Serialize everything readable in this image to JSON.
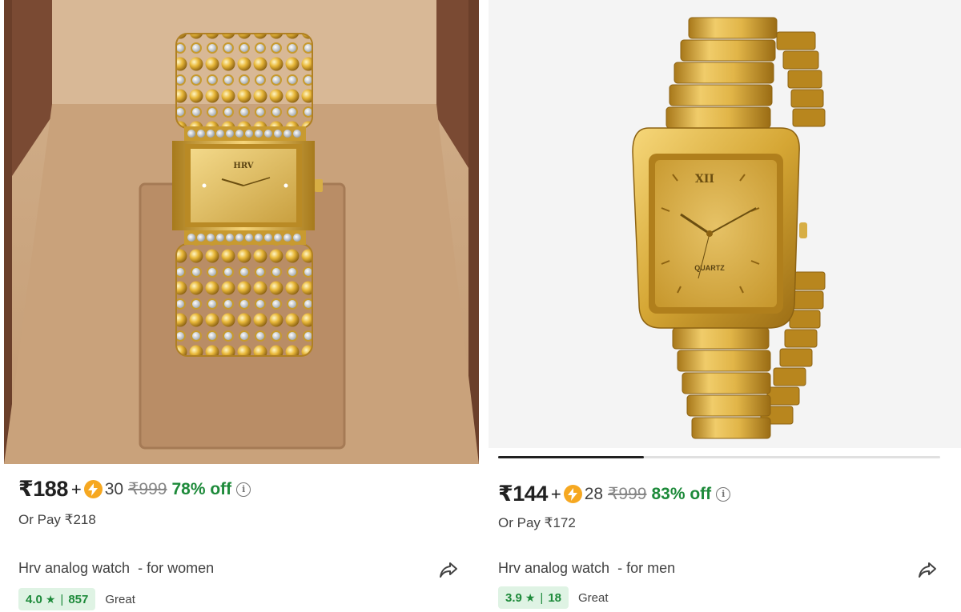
{
  "products": [
    {
      "price": "₹188",
      "plus": "+",
      "coins": "30",
      "mrp": "₹999",
      "discount": "78% off",
      "or_pay": "Or Pay ₹218",
      "title": "Hrv analog watch  - for women",
      "rating": "4.0",
      "reviews": "857",
      "rating_label": "Great",
      "image_alt": "gold bracelet watch with crystals in box",
      "dial_brand": "HRV"
    },
    {
      "price": "₹144",
      "plus": "+",
      "coins": "28",
      "mrp": "₹999",
      "discount": "83% off",
      "or_pay": "Or Pay ₹172",
      "title": "Hrv analog watch  - for men",
      "rating": "3.9",
      "reviews": "18",
      "rating_label": "Great",
      "image_alt": "gold rectangular link watch",
      "dial_text": "QUARTZ",
      "dial_numeral": "XII"
    }
  ],
  "icons": {
    "coin": "lightning-coin-icon",
    "info": "info-icon",
    "share": "share-icon",
    "star": "star-icon"
  },
  "carousel": {
    "active_index": 0,
    "progress": 0.33
  },
  "colors": {
    "discount": "#1d8a3a",
    "rating_bg": "#dff3e4",
    "coin": "#f6a821",
    "gold": "#d4a52c"
  }
}
